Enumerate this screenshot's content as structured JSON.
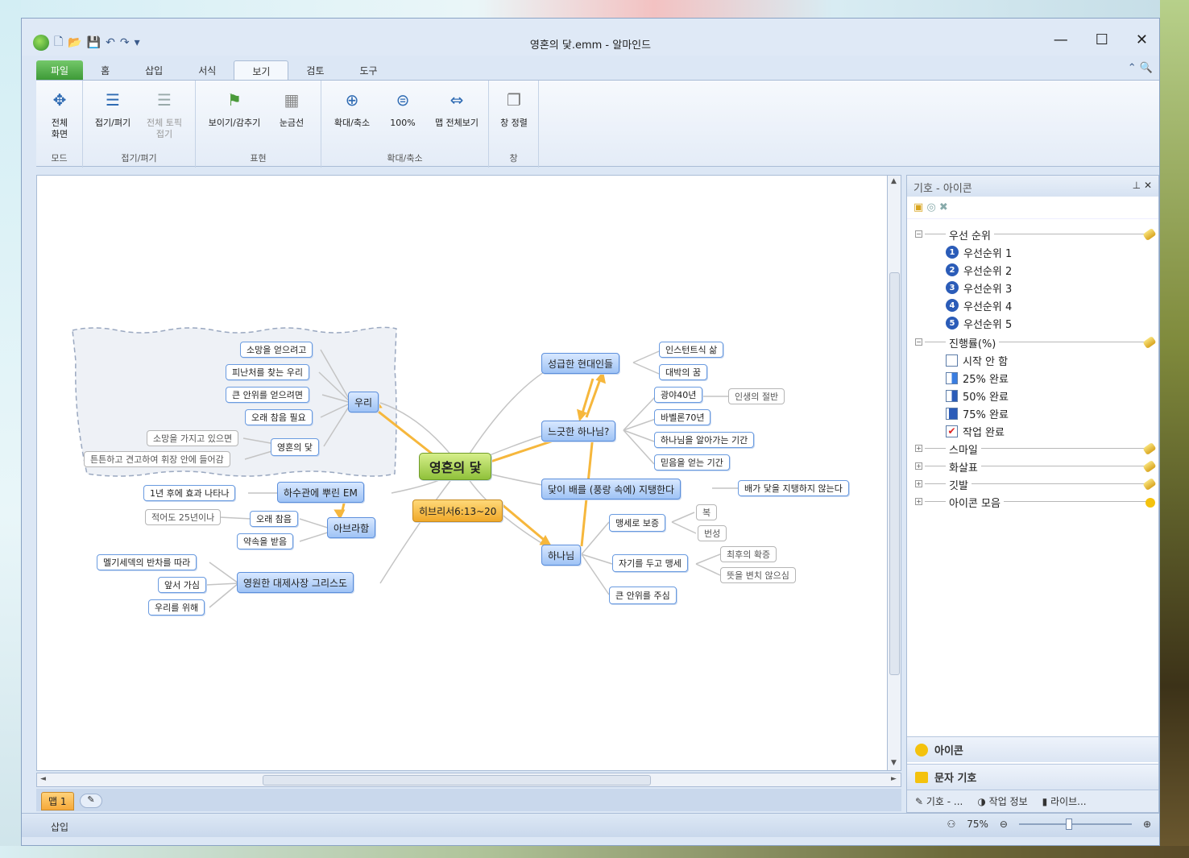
{
  "window": {
    "title": "영혼의 닻.emm - 알마인드",
    "controls": [
      "—",
      "☐",
      "✕"
    ]
  },
  "menu": {
    "tabs": [
      "파일",
      "홈",
      "삽입",
      "서식",
      "보기",
      "검토",
      "도구"
    ],
    "active": "보기"
  },
  "ribbon": {
    "groups": [
      {
        "label": "모드",
        "buttons": [
          "전체\n화면"
        ]
      },
      {
        "label": "접기/펴기",
        "buttons": [
          "접기/펴기",
          "전체 토픽\n접기"
        ]
      },
      {
        "label": "표현",
        "buttons": [
          "보이기/감추기",
          "눈금선"
        ]
      },
      {
        "label": "확대/축소",
        "buttons": [
          "확대/축소",
          "100%",
          "맵 전체보기"
        ]
      },
      {
        "label": "창",
        "buttons": [
          "창 정렬"
        ]
      }
    ]
  },
  "mindmap": {
    "central": "영혼의 닻",
    "verse": "히브리서6:13~20",
    "nodes": {
      "wuri": "우리",
      "hope": "소망을 얻으려고",
      "refuge": "피난처를 찾는 우리",
      "comfort": "큰 안위를 얻으려면",
      "patience": "오래 참음 필요",
      "anchor": "영혼의 닻",
      "holding_hope": "소망을 가지고 있으면",
      "firm": "튼튼하고 견고하여 휘장 안에 들어감",
      "em": "하수관에 뿌린 EM",
      "year": "1년 후에 효과 나타나",
      "abraham": "아브라함",
      "long_wait": "오래 참음",
      "at_least": "적어도 25년이나",
      "promise": "약속을 받음",
      "priest": "영원한 대제사장 그리스도",
      "melchizedek": "멜기세덱의 반차를 따라",
      "ahead": "앞서 가심",
      "for_us": "우리를 위해",
      "hasty": "성급한 현대인들",
      "instant": "인스턴트식 삶",
      "jackpot": "대박의 꿈",
      "slow_god": "느긋한 하나님?",
      "wild": "광야40년",
      "half_life": "인생의 절반",
      "babylon": "바벨론70년",
      "know_god": "하나님을 알아가는 기간",
      "gain_faith": "믿음을 얻는 기간",
      "ship": "닻이 배를 (풍랑 속에) 지탱한다",
      "sink": "배가 닻을 지탱하지 않는다",
      "god": "하나님",
      "oath": "맹세로 보증",
      "bless": "복",
      "multiply": "번성",
      "self_oath": "자기를 두고 맹세",
      "final": "최후의 확증",
      "unchanging": "뜻을 변치 않으심",
      "great_comfort": "큰 안위를 주심"
    }
  },
  "scroll": {
    "left_arrow": "◄",
    "right_arrow": "►",
    "up_arrow": "▲",
    "down_arrow": "▼"
  },
  "map_tab": "맵 1",
  "status": {
    "left": "삽입",
    "zoom": "75%"
  },
  "panel": {
    "title": "기호 - 아이콘",
    "groups": [
      {
        "name": "우선 순위",
        "expanded": true,
        "items": [
          "우선순위 1",
          "우선순위 2",
          "우선순위 3",
          "우선순위 4",
          "우선순위 5"
        ]
      },
      {
        "name": "진행률(%)",
        "expanded": true,
        "items": [
          "시작 안 함",
          "25% 완료",
          "50% 완료",
          "75% 완료",
          "작업 완료"
        ]
      },
      {
        "name": "스마일",
        "expanded": false
      },
      {
        "name": "화살표",
        "expanded": false
      },
      {
        "name": "깃발",
        "expanded": false
      },
      {
        "name": "아이콘 모음",
        "expanded": false
      }
    ],
    "sections": [
      "아이콘",
      "문자 기호"
    ],
    "tabs": [
      "기호 - ...",
      "작업 정보",
      "라이브..."
    ]
  },
  "colors": {
    "accent_blue": "#5c8fdc",
    "central_green": "#8fc13a",
    "verse_orange": "#f0a92a",
    "arrow_yellow": "#f6b73c"
  }
}
